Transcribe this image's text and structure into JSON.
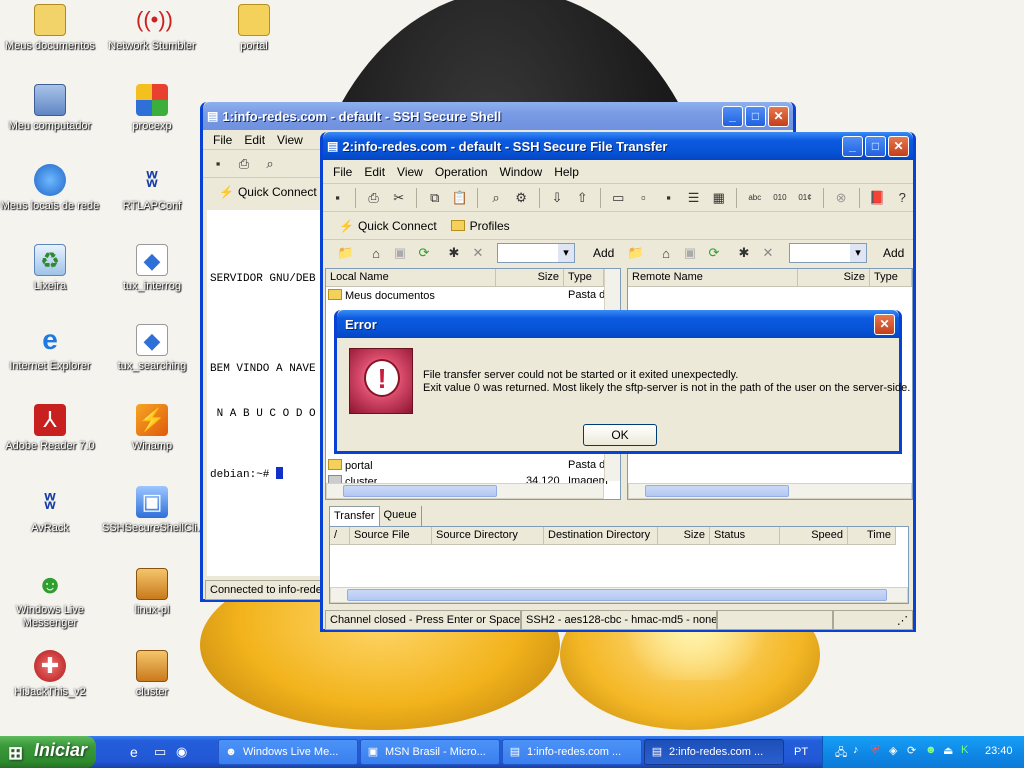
{
  "desktop": {
    "icons": [
      {
        "label": "Meus documentos",
        "icon": "my-documents-icon"
      },
      {
        "label": "Network Stumbler",
        "icon": "network-stumbler-icon"
      },
      {
        "label": "portal",
        "icon": "folder-icon"
      },
      {
        "label": "Meu computador",
        "icon": "my-computer-icon"
      },
      {
        "label": "procexp",
        "icon": "procexp-icon"
      },
      {
        "label": "Meus locais de rede",
        "icon": "network-places-icon"
      },
      {
        "label": "RTLAPConf",
        "icon": "realtek-icon"
      },
      {
        "label": "Lixeira",
        "icon": "recycle-bin-icon"
      },
      {
        "label": "tux_interrog",
        "icon": "image-icon"
      },
      {
        "label": "Internet Explorer",
        "icon": "internet-explorer-icon"
      },
      {
        "label": "tux_searching",
        "icon": "image-icon"
      },
      {
        "label": "Adobe Reader 7.0",
        "icon": "adobe-reader-icon"
      },
      {
        "label": "Winamp",
        "icon": "winamp-icon"
      },
      {
        "label": "AvRack",
        "icon": "realtek-icon"
      },
      {
        "label": "SSHSecureShellCli...",
        "icon": "ssh-client-icon"
      },
      {
        "label": "Windows Live Messenger",
        "icon": "messenger-icon"
      },
      {
        "label": "linux-pl",
        "icon": "archive-icon"
      },
      {
        "label": "HiJackThis_v2",
        "icon": "hijackthis-icon"
      },
      {
        "label": "cluster",
        "icon": "archive-icon"
      }
    ]
  },
  "ssh_shell": {
    "title": "1:info-redes.com - default - SSH Secure Shell",
    "menu": [
      "File",
      "Edit",
      "View"
    ],
    "quick_connect": "Quick Connect",
    "terminal": {
      "line1": "SERVIDOR GNU/DEB",
      "line2": "BEM VINDO A NAVE",
      "line3": " N A B U C O D O",
      "prompt": "debian:~# "
    },
    "status": "Connected to info-redes"
  },
  "sftp": {
    "title": "2:info-redes.com - default - SSH Secure File Transfer",
    "menu": [
      "File",
      "Edit",
      "View",
      "Operation",
      "Window",
      "Help"
    ],
    "quick_connect": "Quick Connect",
    "profiles": "Profiles",
    "add_label": "Add",
    "local": {
      "headers": {
        "name": "Local Name",
        "size": "Size",
        "type": "Type"
      },
      "rows": [
        {
          "name": "Meus documentos",
          "size": "",
          "type": "Pasta d"
        },
        {
          "name": "portal",
          "size": "",
          "type": "Pasta d"
        },
        {
          "name": "cluster",
          "size": "34.120",
          "type": "Imagem"
        }
      ]
    },
    "remote": {
      "headers": {
        "name": "Remote Name",
        "size": "Size",
        "type": "Type"
      }
    },
    "tabs": [
      "Transfer",
      "Queue"
    ],
    "transfer_headers": [
      "/",
      "Source File",
      "Source Directory",
      "Destination Directory",
      "Size",
      "Status",
      "Speed",
      "Time"
    ],
    "status_left": "Channel closed - Press Enter or Space to",
    "status_right": "SSH2 - aes128-cbc - hmac-md5 - none"
  },
  "error_dialog": {
    "title": "Error",
    "line1": "File transfer server could not be started or it exited unexpectedly.",
    "line2": "Exit value 0 was returned. Most likely the sftp-server is not in the path of the user on the server-side.",
    "ok": "OK"
  },
  "taskbar": {
    "start": "Iniciar",
    "tasks": [
      {
        "label": "Windows Live Me..."
      },
      {
        "label": "MSN Brasil - Micro..."
      },
      {
        "label": "1:info-redes.com ..."
      },
      {
        "label": "2:info-redes.com ..."
      }
    ],
    "language": "PT",
    "clock": "23:40"
  },
  "colors": {
    "title_active": "#0753d6",
    "title_inactive": "#7a9be4",
    "taskbar": "#245edb",
    "start": "#3c9a3c"
  }
}
